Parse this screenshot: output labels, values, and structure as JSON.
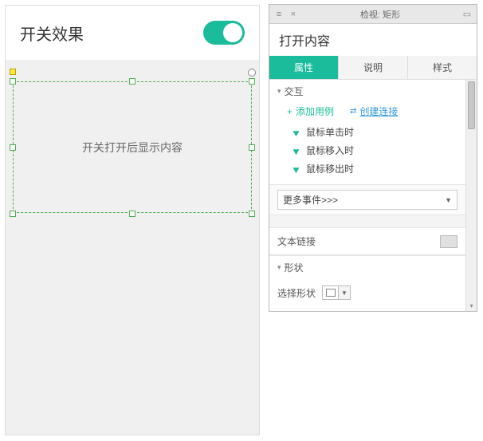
{
  "canvas": {
    "title": "开关效果",
    "selection_label": "开关打开后显示内容"
  },
  "inspector": {
    "titlebar": "检视: 矩形",
    "widget_name": "打开内容",
    "tabs": {
      "props": "属性",
      "notes": "说明",
      "style": "样式"
    },
    "sections": {
      "interactions": "交互",
      "text_link": "文本链接",
      "shape": "形状"
    },
    "actions": {
      "add_case": "添加用例",
      "create_link": "创建连接"
    },
    "events": {
      "click": "鼠标单击时",
      "mouseenter": "鼠标移入时",
      "mouseleave": "鼠标移出时"
    },
    "more_events": "更多事件>>>",
    "shape_label": "选择形状"
  }
}
